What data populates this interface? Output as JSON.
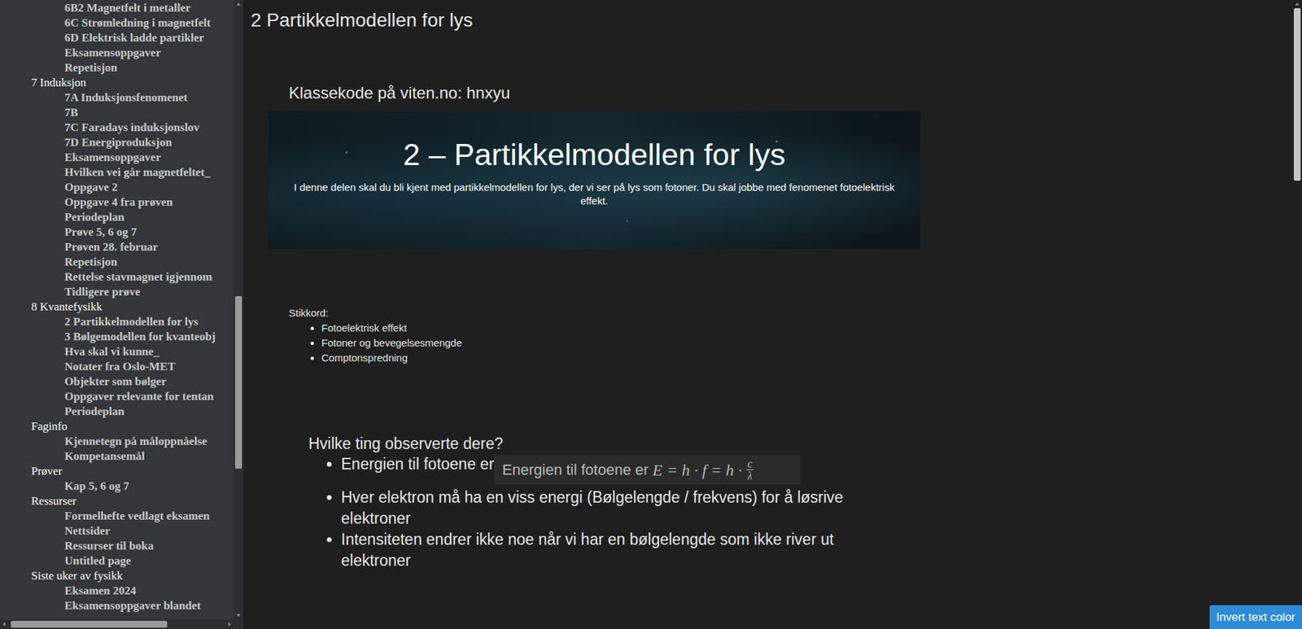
{
  "sidebar": {
    "items": [
      {
        "label": "6B2 Magnetfelt i metaller",
        "kind": "page"
      },
      {
        "label": "6C Strømledning i magnetfelt",
        "kind": "page"
      },
      {
        "label": "6D Elektrisk ladde partikler",
        "kind": "page"
      },
      {
        "label": "Eksamensoppgaver",
        "kind": "page"
      },
      {
        "label": "Repetisjon",
        "kind": "page"
      },
      {
        "label": "7 Induksjon",
        "kind": "section"
      },
      {
        "label": "7A Induksjonsfenomenet",
        "kind": "page"
      },
      {
        "label": "7B",
        "kind": "page"
      },
      {
        "label": "7C Faradays induksjonslov",
        "kind": "page"
      },
      {
        "label": "7D Energiproduksjon",
        "kind": "page"
      },
      {
        "label": "Eksamensoppgaver",
        "kind": "page"
      },
      {
        "label": "Hvilken vei går magnetfeltet_",
        "kind": "page"
      },
      {
        "label": "Oppgave 2",
        "kind": "page"
      },
      {
        "label": "Oppgave 4 fra prøven",
        "kind": "page"
      },
      {
        "label": "Periodeplan",
        "kind": "page"
      },
      {
        "label": "Prøve 5, 6 og 7",
        "kind": "page"
      },
      {
        "label": "Prøven 28. februar",
        "kind": "page"
      },
      {
        "label": "Repetisjon",
        "kind": "page"
      },
      {
        "label": "Rettelse stavmagnet igjennom",
        "kind": "page"
      },
      {
        "label": "Tidligere prøve",
        "kind": "page"
      },
      {
        "label": "8 Kvantefysikk",
        "kind": "section"
      },
      {
        "label": "2 Partikkelmodellen for lys",
        "kind": "page"
      },
      {
        "label": "3 Bølgemodellen for kvanteobj",
        "kind": "page"
      },
      {
        "label": "Hva skal vi kunne_",
        "kind": "page"
      },
      {
        "label": "Notater fra Oslo-MET",
        "kind": "page"
      },
      {
        "label": "Objekter som bølger",
        "kind": "page"
      },
      {
        "label": "Oppgaver relevante for tentan",
        "kind": "page"
      },
      {
        "label": "Periodeplan",
        "kind": "page"
      },
      {
        "label": "Faginfo",
        "kind": "section"
      },
      {
        "label": "Kjennetegn på måloppnåelse",
        "kind": "page"
      },
      {
        "label": "Kompetansemål",
        "kind": "page"
      },
      {
        "label": "Prøver",
        "kind": "section"
      },
      {
        "label": "Kap 5, 6 og 7",
        "kind": "page"
      },
      {
        "label": "Ressurser",
        "kind": "section"
      },
      {
        "label": "Formelhefte vedlagt eksamen",
        "kind": "page"
      },
      {
        "label": "Nettsider",
        "kind": "page"
      },
      {
        "label": "Ressurser til boka",
        "kind": "page"
      },
      {
        "label": "Untitled page",
        "kind": "page"
      },
      {
        "label": "Siste uker av fysikk",
        "kind": "section"
      },
      {
        "label": "Eksamen 2024",
        "kind": "page"
      },
      {
        "label": "Eksamensoppgaver blandet",
        "kind": "page"
      }
    ]
  },
  "page": {
    "title": "2 Partikkelmodellen for lys",
    "class_code": "Klassekode på viten.no: hnxyu",
    "banner": {
      "title": "2 – Partikkelmodellen for lys",
      "subtitle": "I denne delen skal du bli kjent med partikkelmodellen for lys, der vi ser på lys som fotoner. Du skal jobbe med fenomenet fotoelektrisk effekt."
    },
    "keywords_label": "Stikkord:",
    "keywords": [
      "Fotoelektrisk effekt",
      "Fotoner og bevegelsesmengde",
      "Comptonspredning"
    ],
    "heading": "Hvilke ting observerte dere?",
    "observations": [
      {
        "text": "Energien til fotoene er",
        "formula": {
          "text": "Energien til fotoene er",
          "math": "E = h · f = h ·",
          "numerator": "c",
          "denominator": "λ"
        }
      },
      {
        "text": "Hver elektron må ha en viss energi (Bølgelengde / frekvens) for å løsrive elektroner"
      },
      {
        "text": "Intensiteten endrer ikke noe når vi har en bølgelengde som ikke river ut elektroner"
      }
    ]
  },
  "invert_button": "Invert text color"
}
